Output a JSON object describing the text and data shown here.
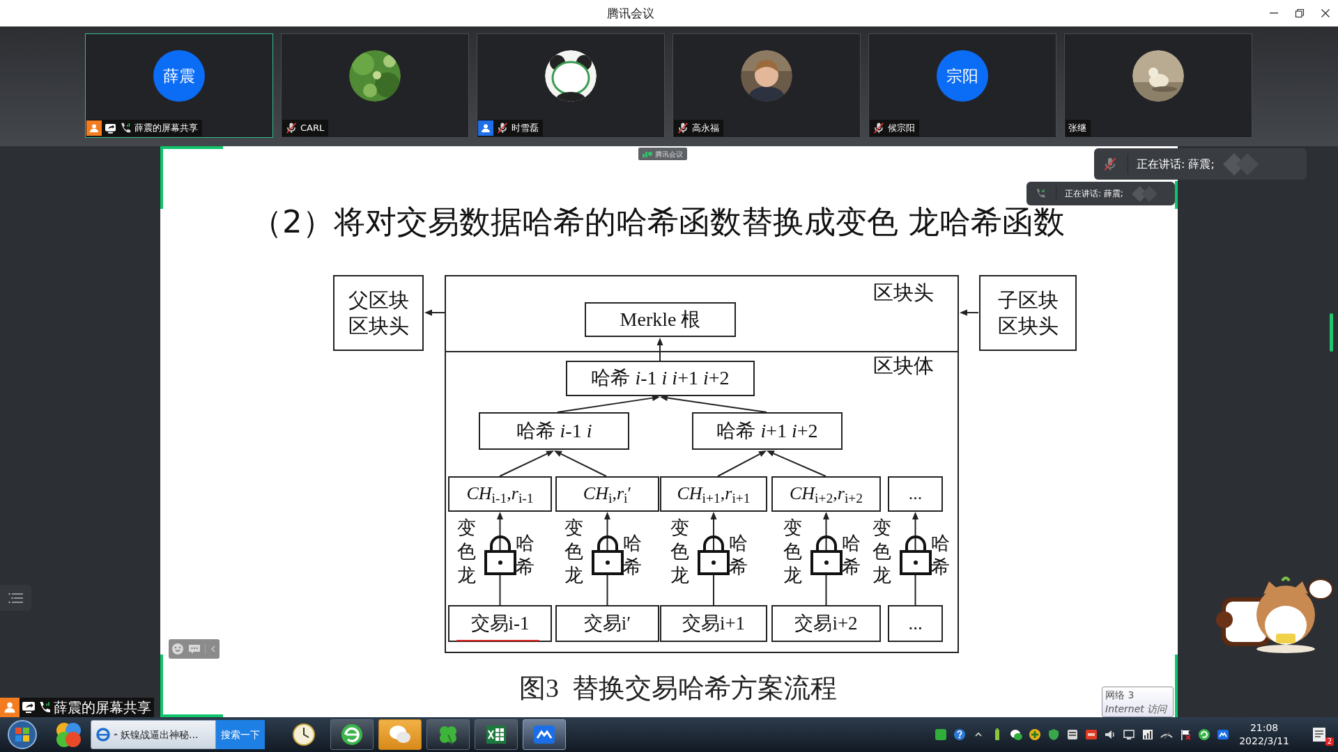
{
  "window": {
    "title": "腾讯会议"
  },
  "participants": [
    {
      "name": "薛震的屏幕共享",
      "avatar": {
        "kind": "initials",
        "text": "薛震"
      },
      "selected": true,
      "badge": {
        "color": "#f47c20"
      },
      "sharing": true,
      "phone": true,
      "muted": false
    },
    {
      "name": "CARL",
      "selected": false,
      "sharing": false,
      "phone": false,
      "muted": true
    },
    {
      "name": "时雪磊",
      "selected": false,
      "badge": {
        "color": "#1e6fe8"
      },
      "sharing": false,
      "phone": false,
      "muted": true
    },
    {
      "name": "高永福",
      "selected": false,
      "sharing": false,
      "phone": false,
      "muted": true
    },
    {
      "name": "候宗阳",
      "avatar": {
        "kind": "initials",
        "text": "宗阳"
      },
      "selected": false,
      "sharing": false,
      "phone": false,
      "muted": true
    },
    {
      "name": "张继",
      "selected": false,
      "sharing": false,
      "phone": false,
      "muted": false
    }
  ],
  "share_tag": {
    "text": "腾讯会议"
  },
  "speaking_popups": [
    {
      "kind": "large",
      "muted": true,
      "phone": false,
      "text": "正在讲话: 薛震;"
    },
    {
      "kind": "small",
      "muted": false,
      "phone": true,
      "text": "正在讲话: 薛震;"
    }
  ],
  "slide": {
    "title": "（2）将对交易数据哈希的哈希函数替换成变色 龙哈希函数",
    "diagram": {
      "parent_block": [
        "父区块",
        "区块头"
      ],
      "child_block": [
        "子区块",
        "区块头"
      ],
      "header_label": "区块头",
      "body_label": "区块体",
      "merkle_root": "Merkle 根",
      "root_hash": "哈希 *i*-1 *i* *i*+1 *i*+2",
      "pair_hashes": [
        "哈希 *i*-1 *i*",
        "哈希 *i*+1 *i*+2"
      ],
      "columns": [
        {
          "commitment": "*CH*$_{i-1}$,*r*$_{i-1}$",
          "left_label": "变色龙",
          "right_label": "哈希",
          "transaction": "交易i-1",
          "annotated": true
        },
        {
          "commitment": "*CH*$_{i}$,*r*$_{i}$′",
          "left_label": "变色龙",
          "right_label": "哈希",
          "transaction": "交易i′",
          "annotated": false
        },
        {
          "commitment": "*CH*$_{i+1}$,*r*$_{i+1}$",
          "left_label": "变色龙",
          "right_label": "哈希",
          "transaction": "交易i+1",
          "annotated": false
        },
        {
          "commitment": "*CH*$_{i+2}$,*r*$_{i+2}$",
          "left_label": "变色龙",
          "right_label": "哈希",
          "transaction": "交易i+2",
          "annotated": false
        },
        {
          "commitment": "...",
          "left_label": "变色龙",
          "right_label": "哈希",
          "transaction": "...",
          "annotated": false
        }
      ]
    },
    "caption": "图3  替换交易哈希方案流程"
  },
  "sharer_label": {
    "badge": {
      "color": "#f47c20"
    },
    "text": "薛震的屏幕共享"
  },
  "network_tooltip": {
    "title": "网络  3",
    "status": "Internet 访问"
  },
  "taskbar": {
    "browser_tab": {
      "title": "妖镍战逼出神秘..."
    },
    "search_button": "搜索一下",
    "apps": [
      {
        "kind": "clock",
        "running": false,
        "flashing": false,
        "selected": false
      },
      {
        "kind": "browser",
        "running": true,
        "flashing": false,
        "selected": false
      },
      {
        "kind": "chat",
        "running": true,
        "flashing": true,
        "selected": false
      },
      {
        "kind": "clover",
        "running": true,
        "flashing": false,
        "selected": false
      },
      {
        "kind": "spreadsheet",
        "running": true,
        "flashing": false,
        "selected": false
      },
      {
        "kind": "meeting",
        "running": true,
        "flashing": false,
        "selected": true
      }
    ],
    "clock": {
      "time": "21:08",
      "date": "2022/3/11"
    },
    "notifications": {
      "count": "2"
    }
  }
}
